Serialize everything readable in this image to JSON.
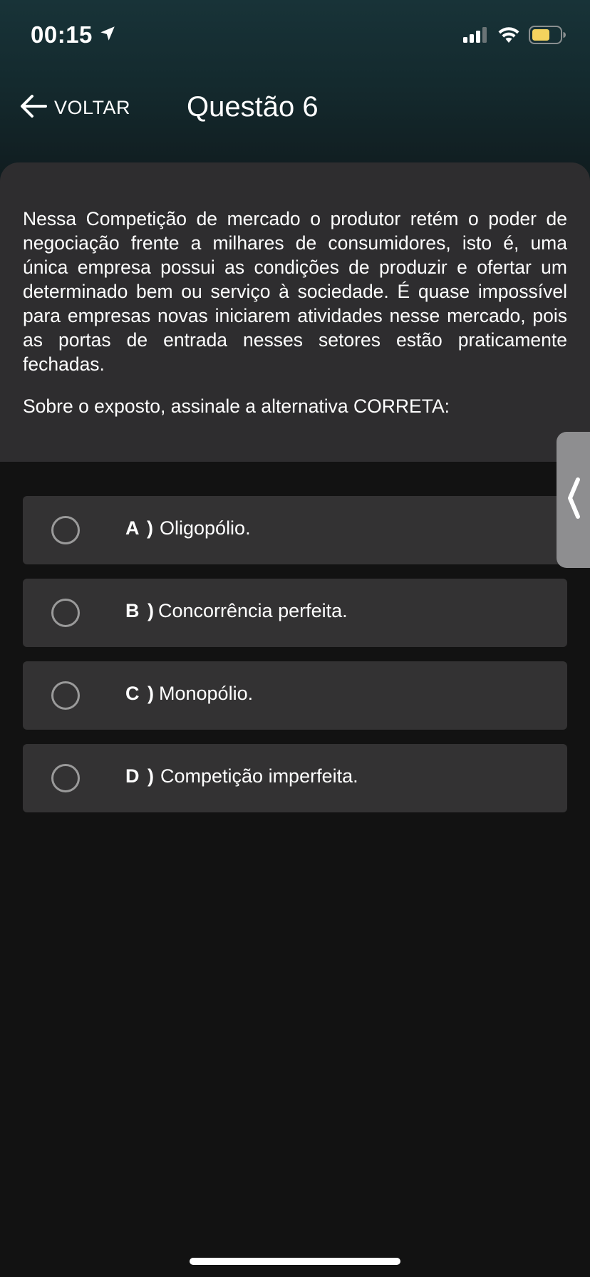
{
  "status_bar": {
    "time": "00:15",
    "icons": [
      "location-arrow-icon",
      "cellular-signal-icon",
      "wifi-icon",
      "battery-icon"
    ],
    "battery_color": "#f4d35e"
  },
  "header": {
    "back_label": "VOLTAR",
    "title": "Questão 6"
  },
  "question": {
    "text": "Nessa Competição de mercado o produtor retém o poder de negociação frente a milhares de consumidores, isto é, uma única empresa possui as condições de produzir e ofertar um determinado bem ou serviço à sociedade. É quase impossível para empresas novas iniciarem atividades nesse mercado, pois as portas de entrada nesses setores estão praticamente fechadas.",
    "prompt": "Sobre o exposto, assinale a alternativa CORRETA:"
  },
  "options": [
    {
      "letter": "A )",
      "text": "Oligopólio."
    },
    {
      "letter": "B )",
      "text": "Concorrência perfeita."
    },
    {
      "letter": "C )",
      "text": "Monopólio."
    },
    {
      "letter": "D )",
      "text": "Competição imperfeita."
    }
  ],
  "side_tab": {
    "icon": "chevron-left-icon"
  },
  "colors": {
    "header_gradient_top": "#183338",
    "card_background": "#2e2d2f",
    "option_background": "#333233",
    "page_background": "#121212",
    "side_tab": "#8e8e90"
  }
}
